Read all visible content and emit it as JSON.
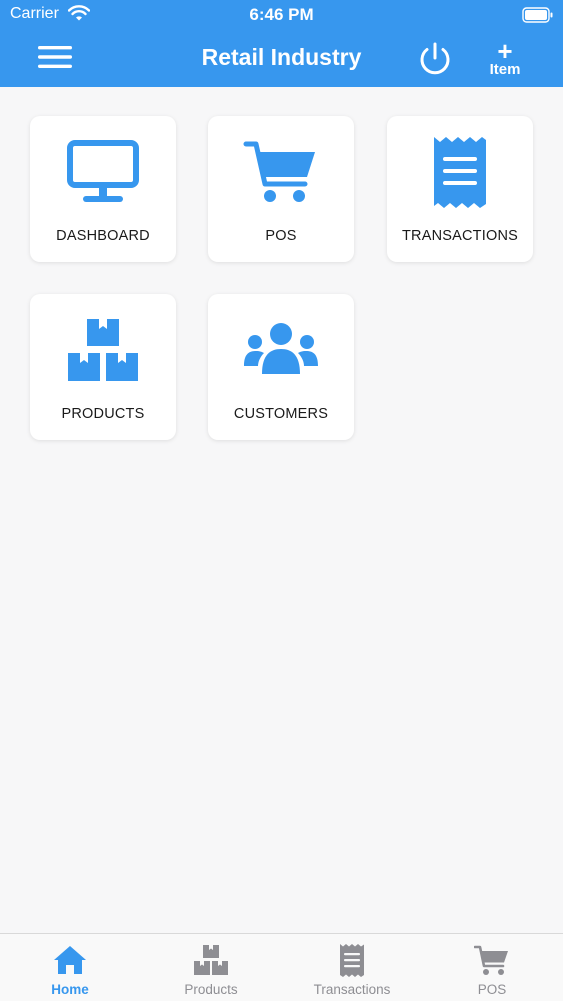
{
  "status_bar": {
    "carrier": "Carrier",
    "time": "6:46 PM"
  },
  "header": {
    "title": "Retail Industry",
    "add_symbol": "+",
    "add_label": "Item",
    "menu_icon": "hamburger-menu-icon",
    "power_icon": "power-icon"
  },
  "tiles": [
    {
      "label": "DASHBOARD",
      "icon": "monitor-icon"
    },
    {
      "label": "POS",
      "icon": "shopping-cart-icon"
    },
    {
      "label": "TRANSACTIONS",
      "icon": "receipt-icon"
    },
    {
      "label": "PRODUCTS",
      "icon": "boxes-icon"
    },
    {
      "label": "CUSTOMERS",
      "icon": "users-icon"
    }
  ],
  "tabbar": {
    "active": "Home",
    "tabs": [
      {
        "label": "Home",
        "icon": "home-icon"
      },
      {
        "label": "Products",
        "icon": "boxes-icon"
      },
      {
        "label": "Transactions",
        "icon": "receipt-icon"
      },
      {
        "label": "POS",
        "icon": "shopping-cart-icon"
      }
    ]
  },
  "colors": {
    "primary": "#3797ee",
    "background": "#f7f7f8",
    "tile": "#ffffff",
    "tab_inactive": "#8e8e93"
  }
}
